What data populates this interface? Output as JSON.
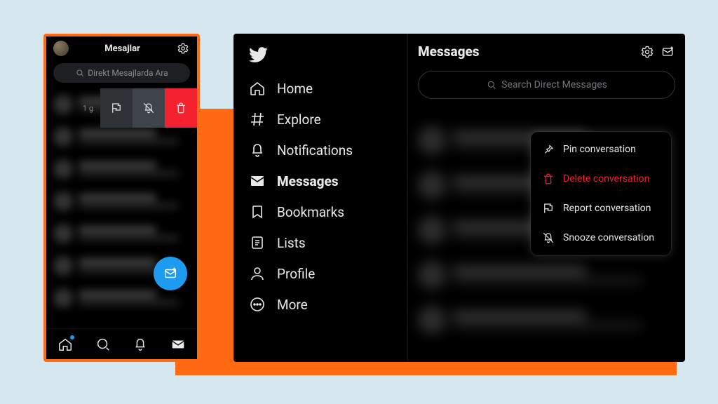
{
  "mobile": {
    "title": "Mesajlar",
    "search_placeholder": "Direkt Mesajlarda Ara",
    "swipe_time": "1 g"
  },
  "desktop": {
    "nav": {
      "home": "Home",
      "explore": "Explore",
      "notifications": "Notifications",
      "messages": "Messages",
      "bookmarks": "Bookmarks",
      "lists": "Lists",
      "profile": "Profile",
      "more": "More"
    },
    "messages": {
      "title": "Messages",
      "search_placeholder": "Search Direct Messages"
    },
    "context_menu": {
      "pin": "Pin conversation",
      "delete": "Delete conversation",
      "report": "Report conversation",
      "snooze": "Snooze conversation"
    }
  },
  "colors": {
    "accent": "#1d9bf0",
    "danger": "#f4212e",
    "orange": "#ff6a13"
  }
}
